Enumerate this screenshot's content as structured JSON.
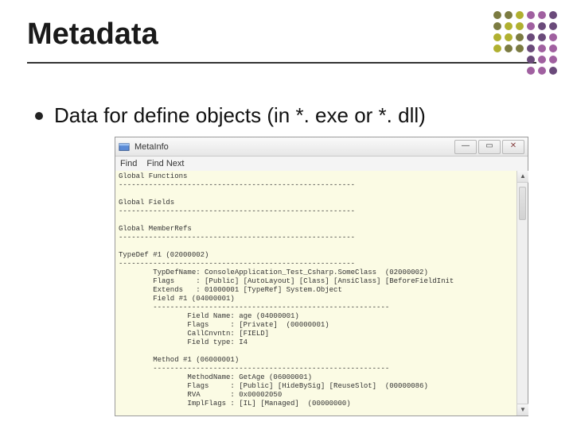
{
  "slide": {
    "title": "Metadata",
    "bullet": "Data for define objects (in *. exe or *. dll)"
  },
  "window": {
    "title": "MetaInfo",
    "menu": {
      "find": "Find",
      "find_next": "Find Next"
    },
    "buttons": {
      "min": "—",
      "max": "▭",
      "close": "✕"
    },
    "content_lines": [
      "Global Functions",
      "-------------------------------------------------------",
      "",
      "Global Fields",
      "-------------------------------------------------------",
      "",
      "Global MemberRefs",
      "-------------------------------------------------------",
      "",
      "TypeDef #1 (02000002)",
      "-------------------------------------------------------",
      "        TypDefName: ConsoleApplication_Test_Csharp.SomeClass  (02000002)",
      "        Flags     : [Public] [AutoLayout] [Class] [AnsiClass] [BeforeFieldInit",
      "        Extends   : 01000001 [TypeRef] System.Object",
      "        Field #1 (04000001)",
      "        -------------------------------------------------------",
      "                Field Name: age (04000001)",
      "                Flags     : [Private]  (00000001)",
      "                CallCnvntn: [FIELD]",
      "                Field type: I4",
      "",
      "        Method #1 (06000001)",
      "        -------------------------------------------------------",
      "                MethodName: GetAge (06000001)",
      "                Flags     : [Public] [HideBySig] [ReuseSlot]  (00000086)",
      "                RVA       : 0x00002050",
      "                ImplFlags : [IL] [Managed]  (00000000)"
    ]
  }
}
